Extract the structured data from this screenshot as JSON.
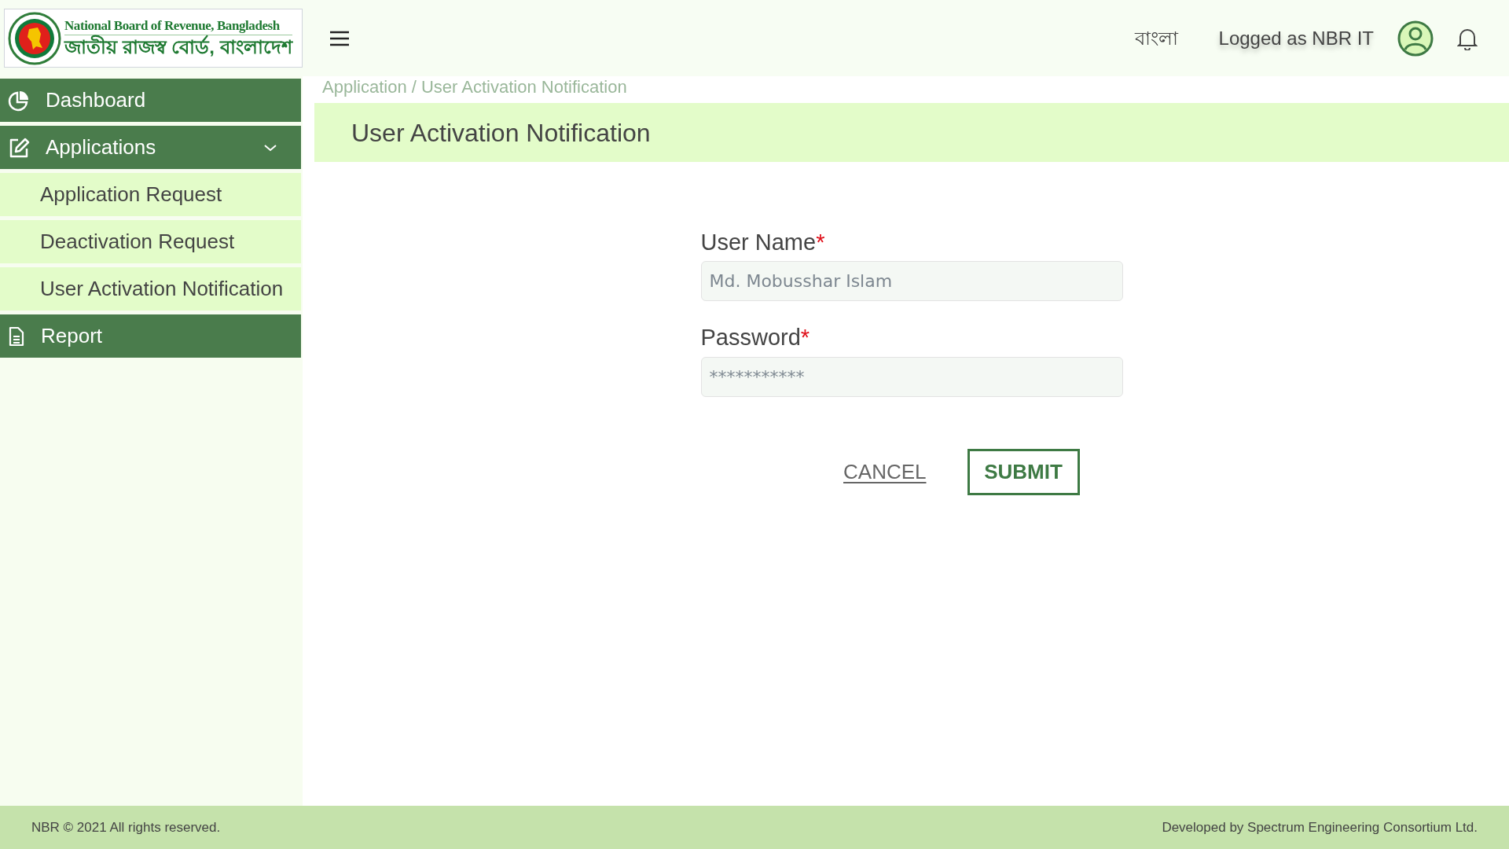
{
  "logo": {
    "title_en": "National Board of Revenue, Bangladesh",
    "title_bn": "জাতীয় রাজস্ব বোর্ড, বাংলাদেশ"
  },
  "header": {
    "language": "বাংলা",
    "user": "Logged as NBR IT"
  },
  "sidebar": {
    "items": [
      {
        "label": "Dashboard"
      },
      {
        "label": "Applications",
        "expanded": true,
        "children": [
          {
            "label": "Application Request"
          },
          {
            "label": "Deactivation Request"
          },
          {
            "label": "User Activation Notification"
          }
        ]
      },
      {
        "label": "Report"
      }
    ]
  },
  "breadcrumb": "Application / User Activation Notification",
  "page_title": "User Activation Notification",
  "form": {
    "fields": [
      {
        "label": "User Name",
        "required_mark": "*",
        "value": "Md. Mobusshar Islam"
      },
      {
        "label": "Password",
        "required_mark": "*",
        "value": "***********"
      }
    ],
    "cancel": "CANCEL",
    "submit": "SUBMIT"
  },
  "footer": {
    "left": "NBR © 2021 All rights reserved.",
    "right": "Developed by Spectrum Engineering Consortium Ltd."
  }
}
